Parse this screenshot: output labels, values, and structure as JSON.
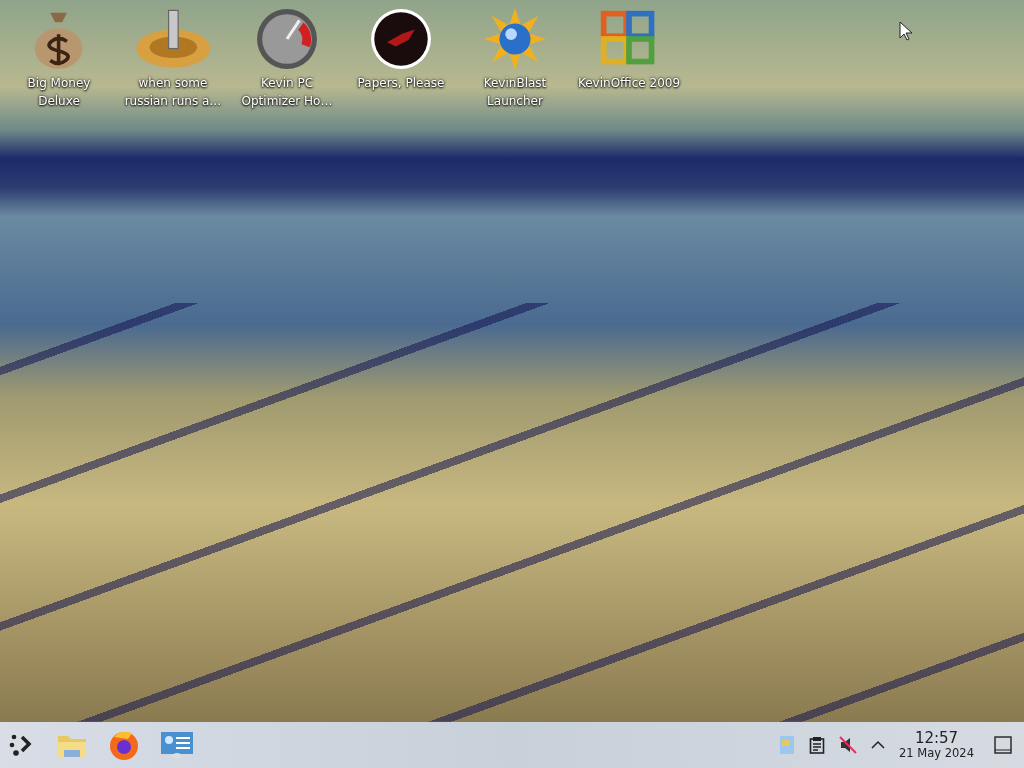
{
  "desktop_icons": [
    {
      "label": "Big Money Deluxe",
      "kind": "moneybag"
    },
    {
      "label": "when some russian runs a…",
      "kind": "gear"
    },
    {
      "label": "Kevin PC Optimizer Ho…",
      "kind": "gauge"
    },
    {
      "label": "Papers, Please",
      "kind": "emblem"
    },
    {
      "label": "KevinBlast Launcher",
      "kind": "sun"
    },
    {
      "label": "KevinOffice 2009",
      "kind": "office"
    }
  ],
  "tray": {
    "volume_muted": true
  },
  "clock": {
    "time": "12:57",
    "date": "21 May 2024"
  }
}
